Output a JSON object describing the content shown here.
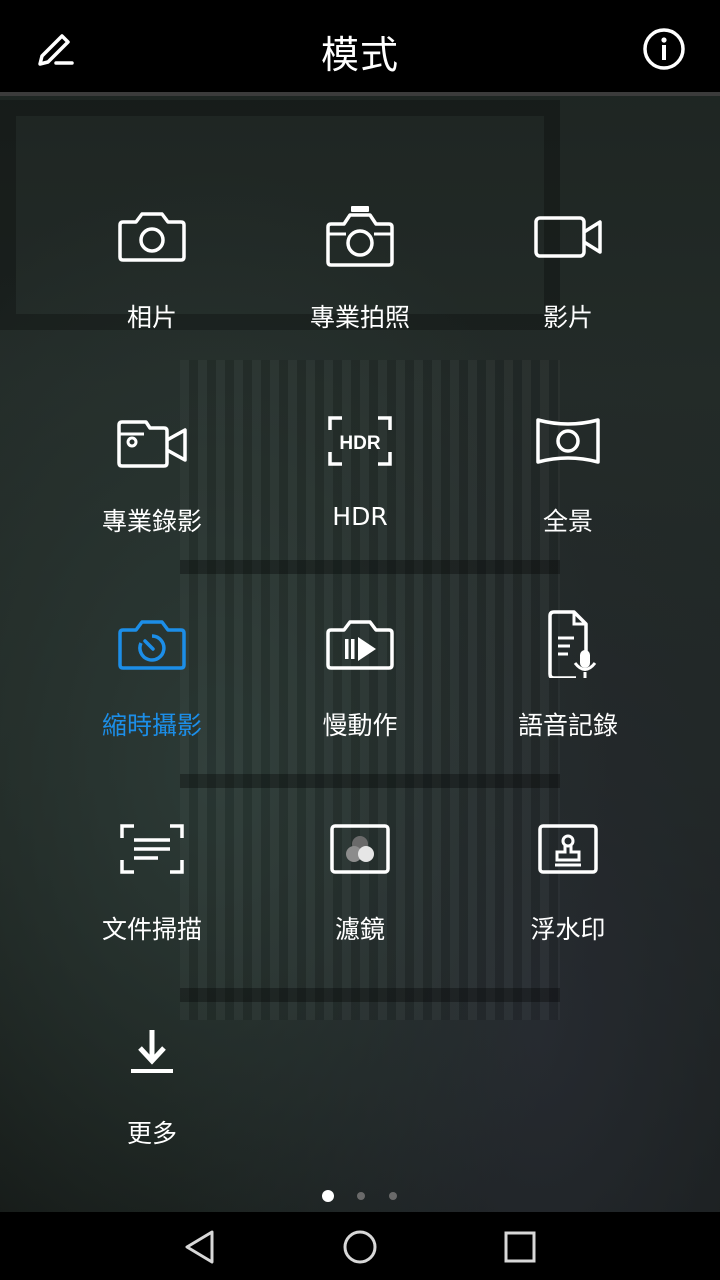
{
  "header": {
    "title": "模式"
  },
  "modes": [
    {
      "label": "相片",
      "icon": "camera-icon"
    },
    {
      "label": "專業拍照",
      "icon": "pro-camera-icon"
    },
    {
      "label": "影片",
      "icon": "video-icon"
    },
    {
      "label": "專業錄影",
      "icon": "pro-video-icon"
    },
    {
      "label": "HDR",
      "icon": "hdr-icon"
    },
    {
      "label": "全景",
      "icon": "panorama-icon"
    },
    {
      "label": "縮時攝影",
      "icon": "timelapse-icon",
      "active": true
    },
    {
      "label": "慢動作",
      "icon": "slow-motion-icon"
    },
    {
      "label": "語音記錄",
      "icon": "audio-note-icon"
    },
    {
      "label": "文件掃描",
      "icon": "document-scan-icon"
    },
    {
      "label": "濾鏡",
      "icon": "filter-icon"
    },
    {
      "label": "浮水印",
      "icon": "watermark-icon"
    },
    {
      "label": "更多",
      "icon": "download-icon"
    }
  ],
  "hdr_icon_text": "HDR",
  "page_indicator": {
    "count": 3,
    "current": 1
  },
  "colors": {
    "accent": "#1c8ee8",
    "text": "#ffffff",
    "bar": "#000000"
  }
}
